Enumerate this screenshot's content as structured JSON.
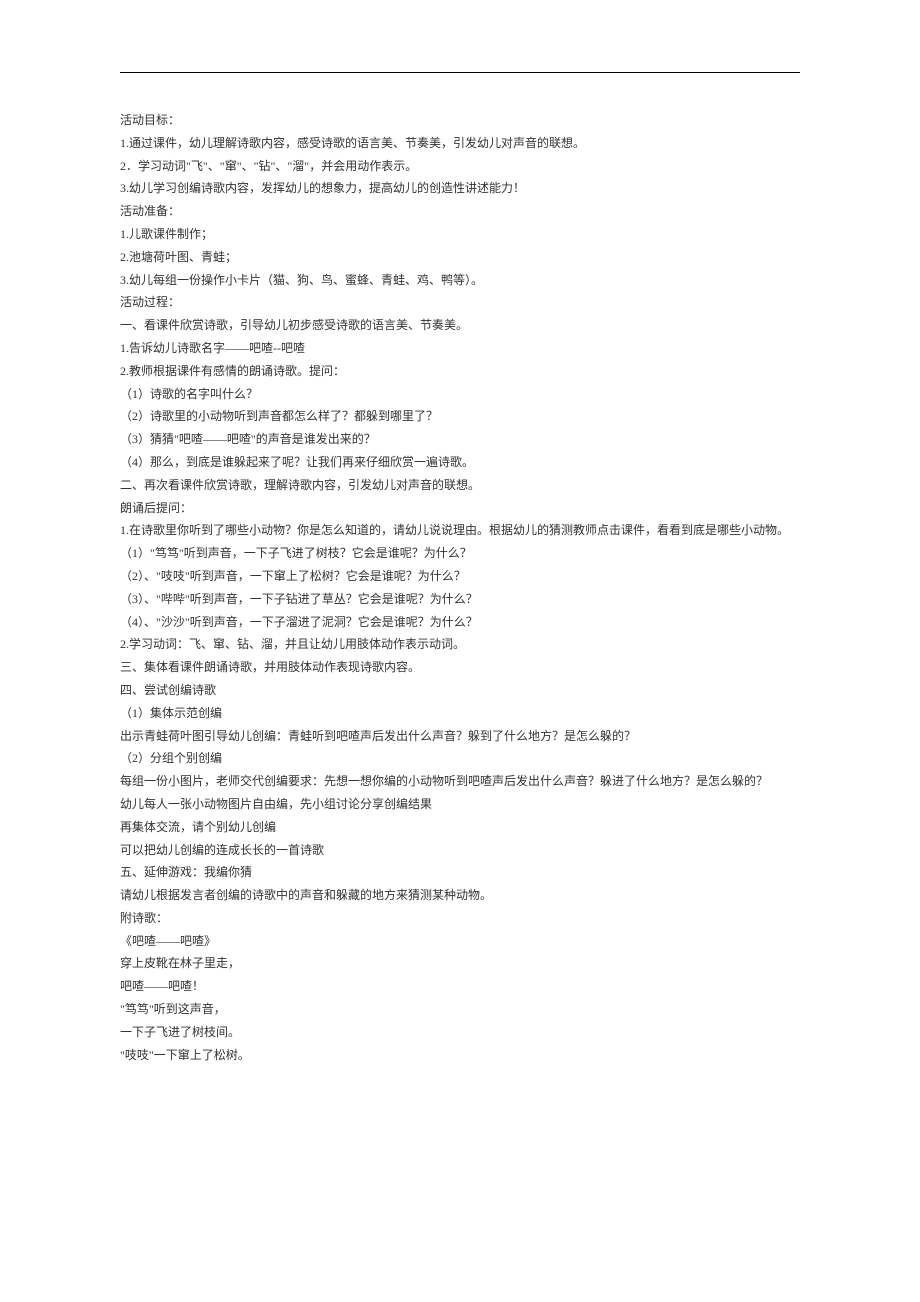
{
  "lines": [
    "活动目标：",
    "1.通过课件，幼儿理解诗歌内容，感受诗歌的语言美、节奏美，引发幼儿对声音的联想。",
    "2．学习动词\"飞\"、\"窜\"、\"钻\"、\"溜\"，并会用动作表示。",
    "3.幼儿学习创编诗歌内容，发挥幼儿的想象力，提高幼儿的创造性讲述能力！",
    "活动准备：",
    "1.儿歌课件制作；",
    "2.池塘荷叶图、青蛙；",
    "3.幼儿每组一份操作小卡片（猫、狗、鸟、蜜蜂、青蛙、鸡、鸭等）。",
    "活动过程：",
    "一、看课件欣赏诗歌，引导幼儿初步感受诗歌的语言美、节奏美。",
    "1.告诉幼儿诗歌名字——吧喳--吧喳",
    "2.教师根据课件有感情的朗诵诗歌。提问：",
    "（1）诗歌的名字叫什么？",
    "（2）诗歌里的小动物听到声音都怎么样了？都躲到哪里了？",
    "（3）猜猜\"吧喳——吧喳\"的声音是谁发出来的？",
    "（4）那么，到底是谁躲起来了呢？让我们再来仔细欣赏一遍诗歌。",
    "二、再次看课件欣赏诗歌，理解诗歌内容，引发幼儿对声音的联想。",
    "朗诵后提问：",
    "1.在诗歌里你听到了哪些小动物？你是怎么知道的，请幼儿说说理由。根据幼儿的猜测教师点击课件，看看到底是哪些小动物。",
    "（1）\"笃笃\"听到声音，一下子飞进了树枝？它会是谁呢？为什么？",
    "（2）、\"吱吱\"听到声音，一下窜上了松树？它会是谁呢？为什么？",
    "（3）、\"哔哔\"听到声音，一下子钻进了草丛？它会是谁呢？为什么？",
    "（4）、\"沙沙\"听到声音，一下子溜进了泥洞？它会是谁呢？为什么？",
    "2.学习动词：飞、窜、钻、溜，并且让幼儿用肢体动作表示动词。",
    "三、集体看课件朗诵诗歌，并用肢体动作表现诗歌内容。",
    "四、尝试创编诗歌",
    "（1）集体示范创编",
    "出示青蛙荷叶图引导幼儿创编：青蛙听到吧喳声后发出什么声音？躲到了什么地方？是怎么躲的？",
    "（2）分组个别创编",
    "每组一份小图片，老师交代创编要求：先想一想你编的小动物听到吧喳声后发出什么声音？躲进了什么地方？是怎么躲的？",
    "幼儿每人一张小动物图片自由编，先小组讨论分享创编结果",
    "再集体交流，请个别幼儿创编",
    "可以把幼儿创编的连成长长的一首诗歌",
    "五、延伸游戏：我编你猜",
    "请幼儿根据发言者创编的诗歌中的声音和躲藏的地方来猜测某种动物。",
    "附诗歌：",
    "《吧喳——吧喳》",
    "穿上皮靴在林子里走，",
    "吧喳——吧喳！",
    "\"笃笃\"听到这声音，",
    "一下子飞进了树枝间。",
    "\"吱吱\"一下窜上了松树。"
  ]
}
